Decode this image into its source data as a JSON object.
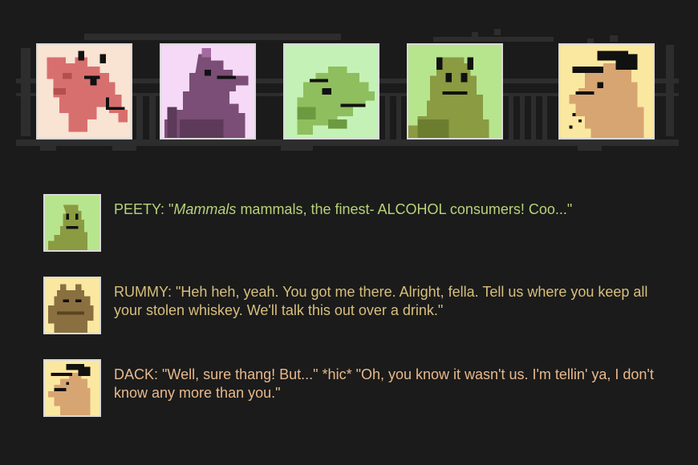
{
  "banner": {
    "characters": [
      {
        "name": "red-horse",
        "bg": "#f9e3d2",
        "body": "#d86f6f",
        "dark": "#111111"
      },
      {
        "name": "purple-bird",
        "bg": "#f5d9f7",
        "body": "#7a4e76",
        "dark": "#111111"
      },
      {
        "name": "green-lizard",
        "bg": "#c4f2b6",
        "body": "#8fbe5e",
        "dark": "#111111"
      },
      {
        "name": "peety-frog",
        "bg": "#b7e58d",
        "body": "#8a9b42",
        "dark": "#111111"
      },
      {
        "name": "dack-dog",
        "bg": "#fbe8a0",
        "body": "#d7a572",
        "dark": "#111111"
      }
    ]
  },
  "dialog": [
    {
      "speaker": "PEETY",
      "prefix": "PEETY: \"",
      "emphasis": "Mammals",
      "rest": " mammals, the finest- ALCOHOL consumers! Coo...\"",
      "color": "#b8d27a",
      "avatar_bg": "#b7e58d",
      "avatar_body": "#8a9b42"
    },
    {
      "speaker": "RUMMY",
      "line": "RUMMY: \"Heh heh, yeah. You got me there. Alright, fella. Tell us where you keep all your stolen whiskey. We'll talk this out over a drink.\"",
      "color": "#d8bf7c",
      "avatar_bg": "#fbe8a0",
      "avatar_body": "#8a7040"
    },
    {
      "speaker": "DACK",
      "line": "DACK: \"Well, sure thang! But...\" *hic* \"Oh, you know it wasn't us. I'm tellin' ya, I don't know any more than you.\"",
      "color": "#e8b98a",
      "avatar_bg": "#fbe8a0",
      "avatar_body": "#d7a572"
    }
  ]
}
